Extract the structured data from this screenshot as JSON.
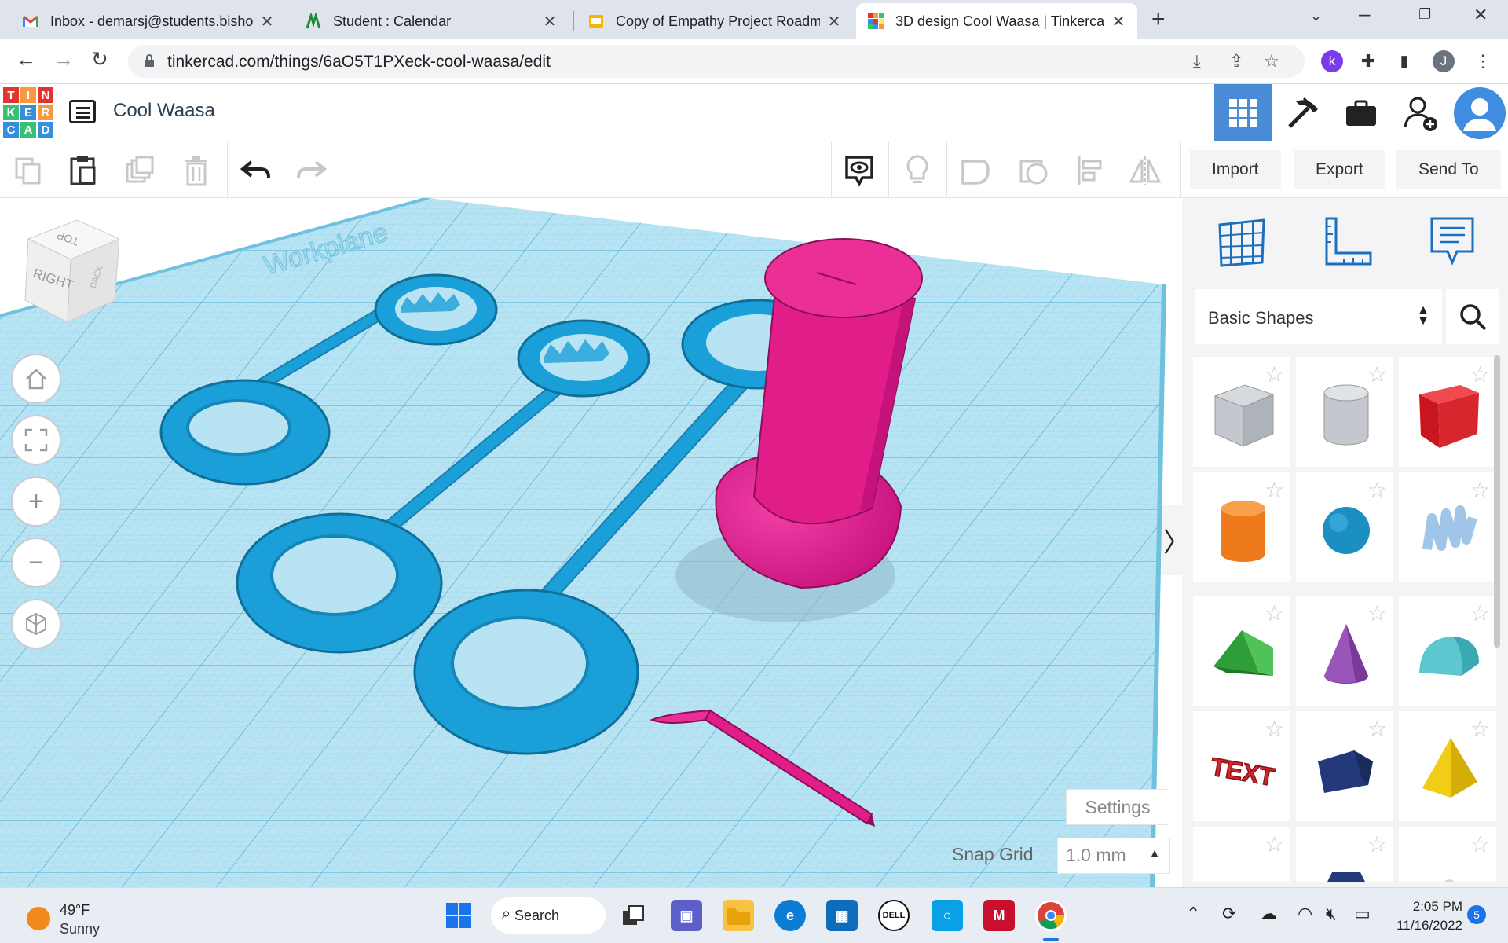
{
  "browser": {
    "tabs": [
      {
        "title": "Inbox - demarsj@students.bishop",
        "icon": "gmail-icon",
        "active": false
      },
      {
        "title": "Student : Calendar",
        "icon": "calendar-icon",
        "active": false
      },
      {
        "title": "Copy of Empathy Project Roadma",
        "icon": "slides-icon",
        "active": false
      },
      {
        "title": "3D design Cool Waasa | Tinkercad",
        "icon": "tinkercad-icon",
        "active": true
      }
    ],
    "url": "tinkercad.com/things/6aO5T1PXeck-cool-waasa/edit",
    "profile_initial": "J",
    "extension_initial": "k"
  },
  "app": {
    "logo_letters": [
      "T",
      "I",
      "N",
      "K",
      "E",
      "R",
      "C",
      "A",
      "D"
    ],
    "design_title": "Cool Waasa",
    "header_icons": [
      "grid-view-icon",
      "pickaxe-icon",
      "briefcase-icon",
      "add-user-icon",
      "user-avatar-icon"
    ]
  },
  "toolbar": {
    "tools": [
      "copy-icon",
      "paste-icon",
      "duplicate-icon",
      "delete-icon",
      "undo-icon",
      "redo-icon"
    ],
    "view_tools": [
      "notes-icon",
      "light-bulb-icon",
      "shape-solid-icon",
      "shape-hole-icon",
      "align-icon",
      "mirror-icon"
    ],
    "import_label": "Import",
    "export_label": "Export",
    "send_to_label": "Send To"
  },
  "viewport": {
    "viewcube": {
      "top": "TOP",
      "right": "RIGHT",
      "back": "BACK"
    },
    "workplane_label": "Workplane",
    "settings_label": "Settings",
    "snap_grid_label": "Snap Grid",
    "snap_grid_value": "1.0 mm"
  },
  "panel": {
    "category": "Basic Shapes",
    "shapes": [
      {
        "name": "Box (hole)",
        "color": "#b8bcc4"
      },
      {
        "name": "Cylinder (hole)",
        "color": "#c4c8ce"
      },
      {
        "name": "Box",
        "color": "#d8262e"
      },
      {
        "name": "Cylinder",
        "color": "#ee7a1c"
      },
      {
        "name": "Sphere",
        "color": "#1b8fc2"
      },
      {
        "name": "Scribble",
        "color": "#9fc6e8"
      },
      {
        "name": "Roof",
        "color": "#2f9e38"
      },
      {
        "name": "Cone",
        "color": "#7b3a9a"
      },
      {
        "name": "Round Roof",
        "color": "#5ec7cf"
      },
      {
        "name": "Text",
        "color": "#d8262e"
      },
      {
        "name": "Polygon",
        "color": "#23397a"
      },
      {
        "name": "Pyramid",
        "color": "#f2cd18"
      }
    ]
  },
  "taskbar": {
    "temperature": "49°F",
    "condition": "Sunny",
    "search_label": "Search",
    "time": "2:05 PM",
    "date": "11/16/2022",
    "notifications": "5"
  }
}
